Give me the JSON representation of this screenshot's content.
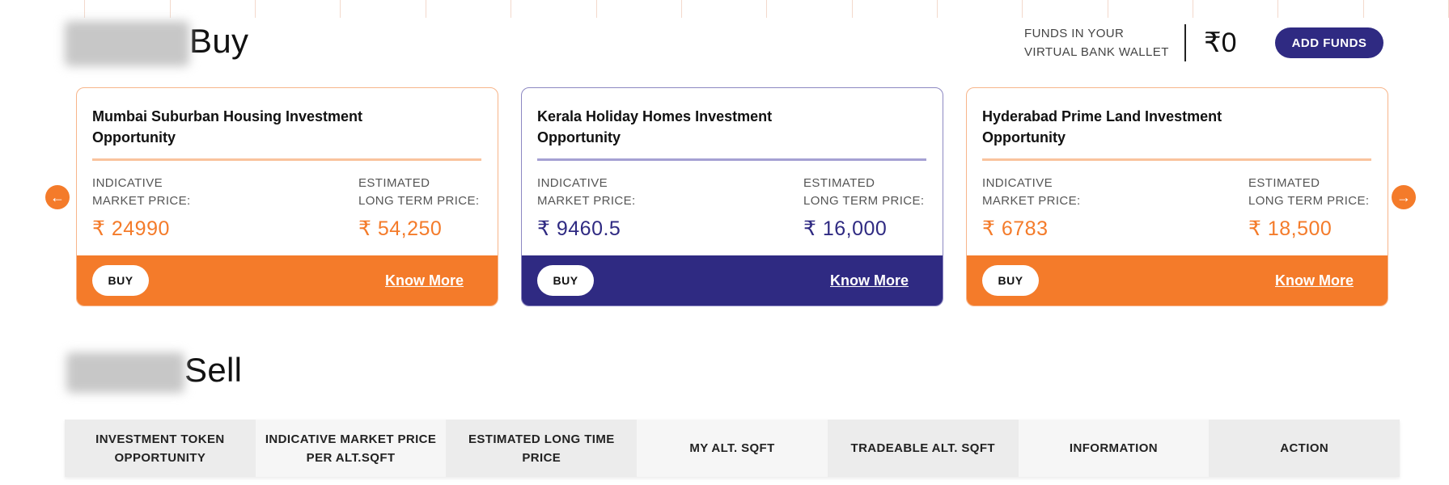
{
  "buy_section": {
    "heading": "Buy"
  },
  "sell_section": {
    "heading": "Sell"
  },
  "wallet": {
    "label_line1": "FUNDS IN YOUR",
    "label_line2": "VIRTUAL BANK WALLET",
    "amount": "₹0",
    "add_funds_label": "ADD FUNDS"
  },
  "carousel": {
    "prev_icon": "←",
    "next_icon": "→",
    "cards": [
      {
        "title": "Mumbai Suburban Housing Investment Opportunity",
        "indicative_label_1": "INDICATIVE",
        "indicative_label_2": "MARKET PRICE:",
        "indicative_price": "₹ 24990",
        "estimated_label_1": "ESTIMATED",
        "estimated_label_2": "LONG TERM PRICE:",
        "estimated_price": "₹ 54,250",
        "buy_label": "BUY",
        "know_more_label": "Know More",
        "theme": "orange",
        "theme_color": "#f47b2a"
      },
      {
        "title": "Kerala Holiday Homes Investment Opportunity",
        "indicative_label_1": "INDICATIVE",
        "indicative_label_2": "MARKET PRICE:",
        "indicative_price": "₹ 9460.5",
        "estimated_label_1": "ESTIMATED",
        "estimated_label_2": "LONG TERM PRICE:",
        "estimated_price": "₹ 16,000",
        "buy_label": "BUY",
        "know_more_label": "Know More",
        "theme": "violet",
        "theme_color": "#2f2a82"
      },
      {
        "title": "Hyderabad Prime Land Investment Opportunity",
        "indicative_label_1": "INDICATIVE",
        "indicative_label_2": "MARKET PRICE:",
        "indicative_price": "₹ 6783",
        "estimated_label_1": "ESTIMATED",
        "estimated_label_2": "LONG TERM PRICE:",
        "estimated_price": "₹ 18,500",
        "buy_label": "BUY",
        "know_more_label": "Know More",
        "theme": "orange",
        "theme_color": "#f47b2a"
      }
    ]
  },
  "table": {
    "columns": [
      "INVESTMENT TOKEN OPPORTUNITY",
      "INDICATIVE MARKET PRICE PER ALT.SQFT",
      "ESTIMATED LONG TIME PRICE",
      "MY ALT. SQFT",
      "TRADEABLE ALT. SQFT",
      "INFORMATION",
      "ACTION"
    ]
  },
  "colors": {
    "accent_orange": "#f47b2a",
    "accent_violet": "#2f2a82"
  }
}
